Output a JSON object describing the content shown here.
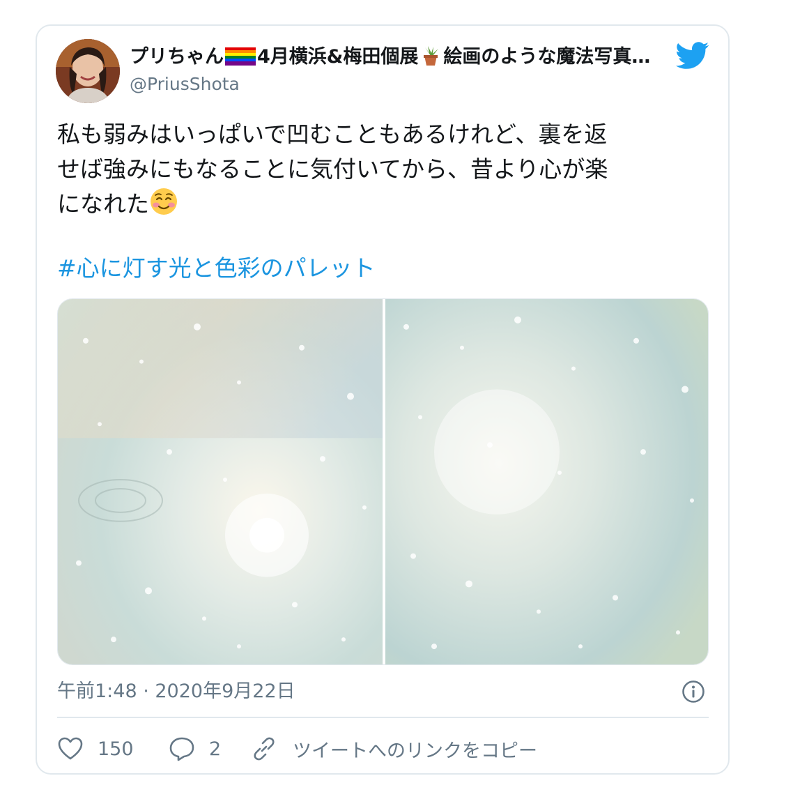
{
  "author": {
    "name_prefix": "プリちゃん",
    "name_mid": "4月横浜&梅田個展",
    "name_suffix": "絵画のような魔法写真…",
    "handle": "@PriusShota"
  },
  "tweet": {
    "text_lines": [
      "私も弱みはいっぱいで凹むこともあるけれど、裏を返",
      "せば強みにもなることに気付いてから、昔より心が楽",
      "になれた"
    ],
    "hashtag": "#心に灯す光と色彩のパレット",
    "timestamp": "午前1:48 · 2020年9月22日"
  },
  "actions": {
    "like_count": "150",
    "reply_count": "2",
    "copy_link_label": "ツイートへのリンクをコピー"
  },
  "icons": {
    "bird": "twitter-bird-icon",
    "info": "info-icon",
    "like": "heart-icon",
    "reply": "reply-bubble-icon",
    "link": "link-icon",
    "rainbow_flag": "rainbow-flag-icon",
    "plant": "potted-plant-icon",
    "emoji": "smiling-face-icon"
  },
  "colors": {
    "accent": "#1da1f2",
    "hashtag": "#1b95e0",
    "secondary_text": "#657786",
    "border": "#e1e8ed"
  }
}
